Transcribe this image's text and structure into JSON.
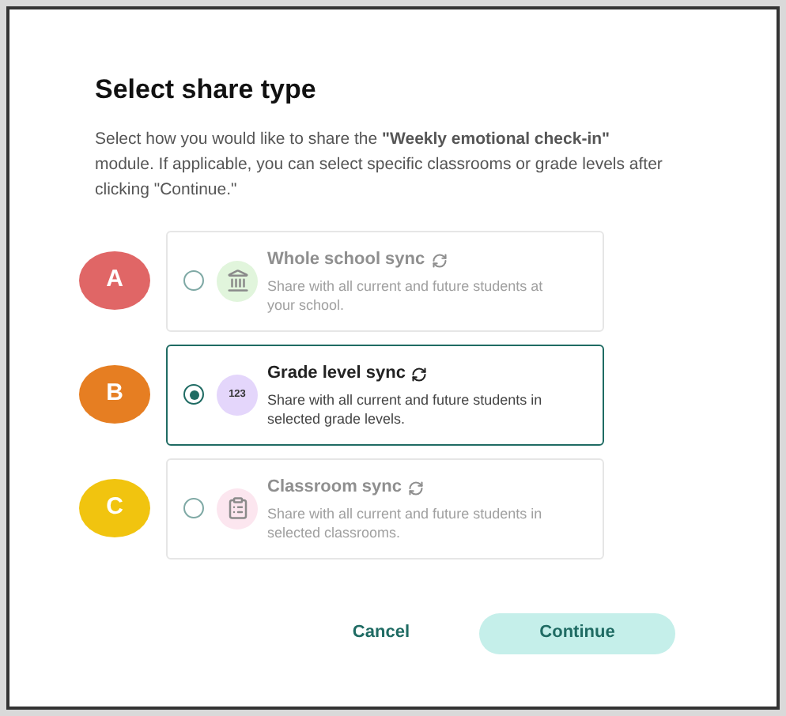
{
  "dialog": {
    "title": "Select share type",
    "description": "Select how you would like to share the **\"Weekly emotional check-in\"** module. If applicable, you can select specific classrooms or grade levels after clicking \"Continue.\""
  },
  "options": [
    {
      "marker": "A",
      "color": "#e06666",
      "icon": {
        "kind": "building",
        "color": "#e1f5dc"
      },
      "title": "Whole school sync",
      "description": "Share with all current and future students at your school.",
      "selected": false
    },
    {
      "marker": "B",
      "color": "#e67e22",
      "icon": {
        "kind": "text",
        "text": "123",
        "color": "#e4d6fb"
      },
      "title": "Grade level sync",
      "description": "Share with all current and future students in selected grade levels.",
      "selected": true
    },
    {
      "marker": "C",
      "color": "#f1c40f",
      "icon": {
        "kind": "clipboard",
        "color": "#fce6ef"
      },
      "title": "Classroom sync",
      "description": "Share with all current and future students in selected classrooms.",
      "selected": false
    }
  ],
  "buttons": {
    "cancel": "Cancel",
    "continue": "Continue"
  }
}
